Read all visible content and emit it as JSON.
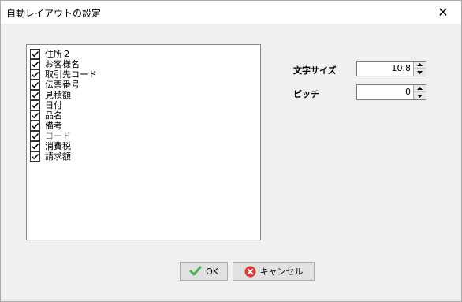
{
  "window": {
    "title": "自動レイアウトの設定",
    "close_glyph": "✕"
  },
  "items": [
    {
      "label": "住所２",
      "checked": true,
      "dim": false
    },
    {
      "label": "お客様名",
      "checked": true,
      "dim": false
    },
    {
      "label": "取引先コード",
      "checked": true,
      "dim": false
    },
    {
      "label": "伝票番号",
      "checked": true,
      "dim": false
    },
    {
      "label": "見積額",
      "checked": true,
      "dim": false
    },
    {
      "label": "日付",
      "checked": true,
      "dim": false
    },
    {
      "label": "品名",
      "checked": true,
      "dim": false
    },
    {
      "label": "備考",
      "checked": true,
      "dim": false
    },
    {
      "label": "コード",
      "checked": true,
      "dim": true
    },
    {
      "label": "消費税",
      "checked": true,
      "dim": false
    },
    {
      "label": "請求額",
      "checked": true,
      "dim": false
    }
  ],
  "settings": {
    "font_size_label": "文字サイズ",
    "font_size_value": "10.8",
    "pitch_label": "ピッチ",
    "pitch_value": "0"
  },
  "buttons": {
    "ok_label": "OK",
    "cancel_label": "キャンセル"
  },
  "colors": {
    "ok_check": "#4caf50",
    "cancel_circle": "#e53935"
  },
  "icons": {
    "ok": "check-icon",
    "cancel": "cancel-icon"
  }
}
